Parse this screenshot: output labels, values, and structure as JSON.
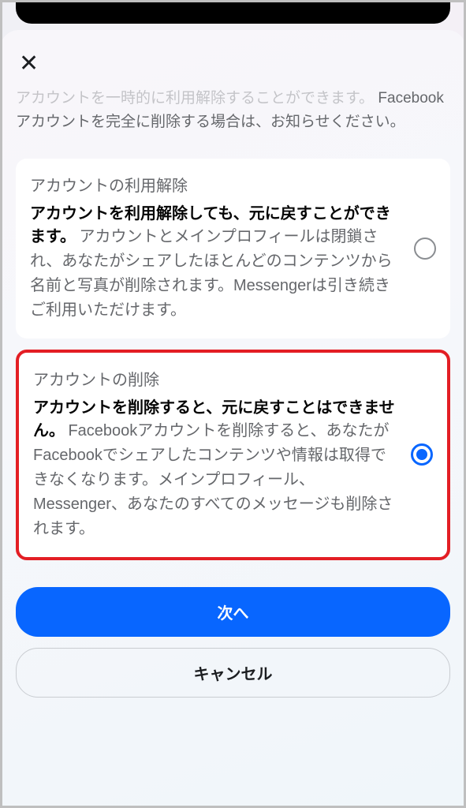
{
  "intro": {
    "faded_line": "アカウントを一時的に利用解除することができます。",
    "main_line": "Facebookアカウントを完全に削除する場合は、お知らせください。"
  },
  "options": {
    "deactivate": {
      "title": "アカウントの利用解除",
      "bold": "アカウントを利用解除しても、元に戻すことができます。",
      "body": "アカウントとメインプロフィールは閉鎖され、あなたがシェアしたほとんどのコンテンツから名前と写真が削除されます。Messengerは引き続きご利用いただけます。",
      "selected": false
    },
    "delete": {
      "title": "アカウントの削除",
      "bold": "アカウントを削除すると、元に戻すことはできません。",
      "body": "Facebookアカウントを削除すると、あなたがFacebookでシェアしたコンテンツや情報は取得できなくなります。メインプロフィール、Messenger、あなたのすべてのメッセージも削除されます。",
      "selected": true
    }
  },
  "buttons": {
    "next": "次へ",
    "cancel": "キャンセル"
  }
}
